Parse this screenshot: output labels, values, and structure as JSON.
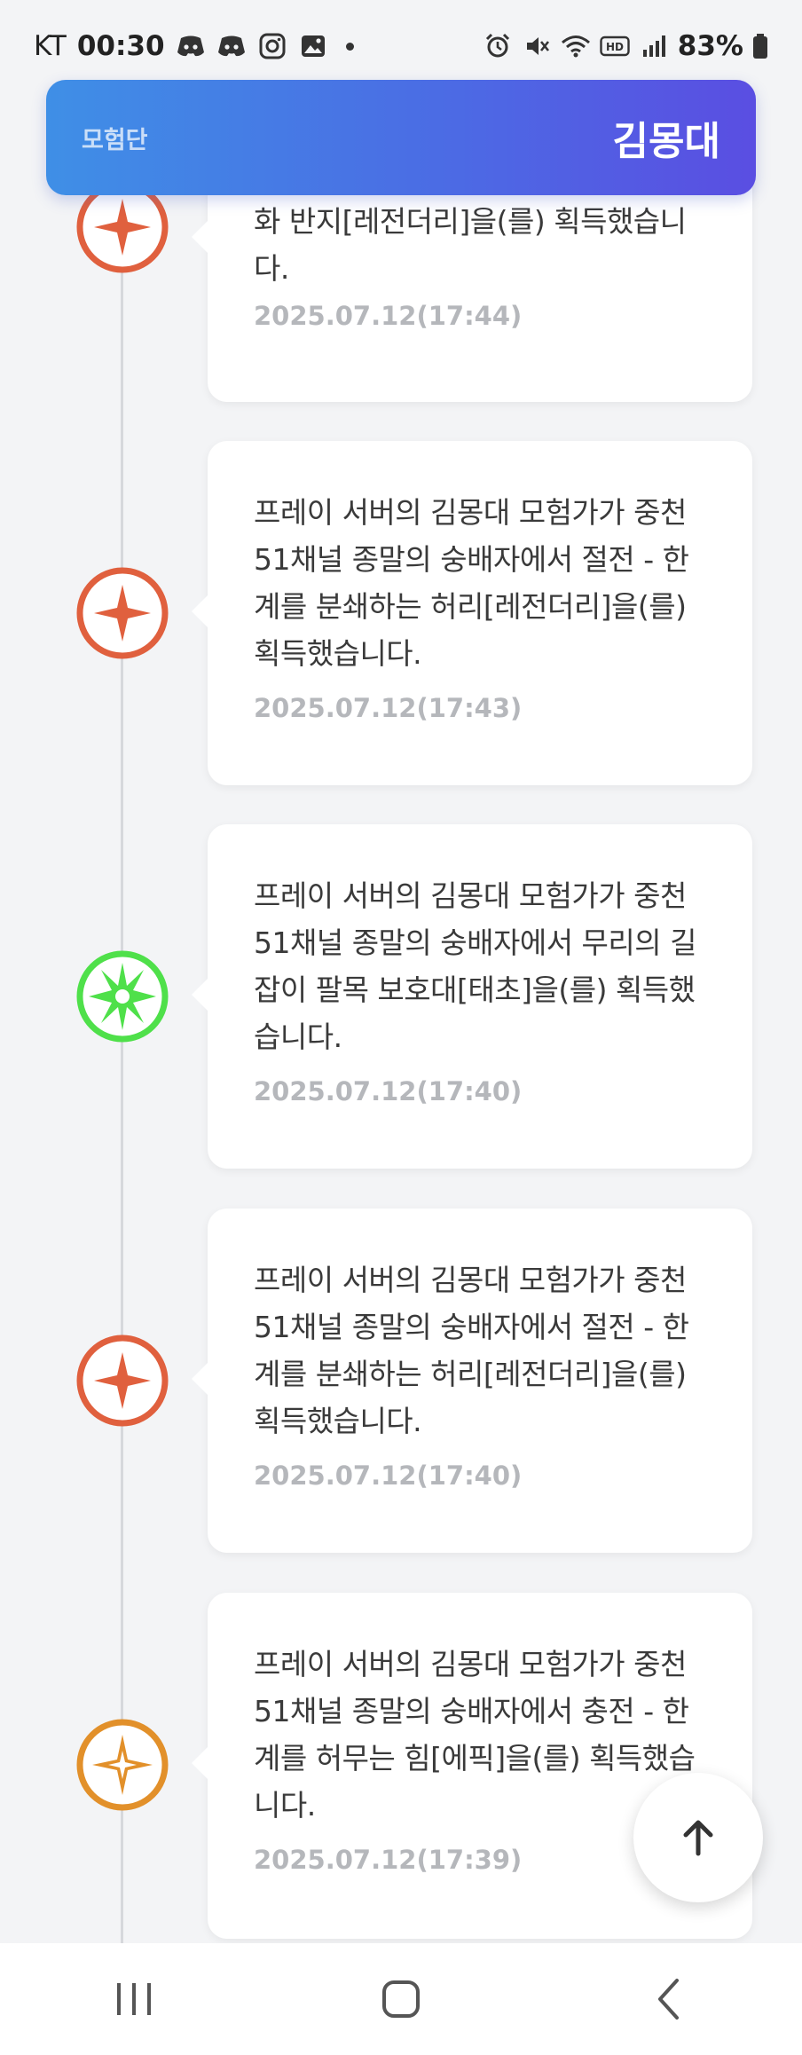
{
  "status_bar": {
    "carrier": "KT",
    "time": "00:30",
    "battery": "83%",
    "left_icons": [
      "discord-icon",
      "discord-icon",
      "instagram-icon",
      "gallery-icon"
    ],
    "right_icons": [
      "alarm-icon",
      "mute-icon",
      "wifi-icon",
      "hd-voice-icon",
      "signal-icon",
      "battery-icon"
    ]
  },
  "header": {
    "subtitle": "모험단",
    "title": "김몽대"
  },
  "feed": [
    {
      "message": "화 반지[레전더리]을(를) 획득했습니\n다.",
      "timestamp": "2025.07.12(17:44)",
      "rarity": "legendary",
      "color": "#e0603e"
    },
    {
      "message": "프레이 서버의 김몽대 모험가가 중천\n51채널 종말의 숭배자에서 절전 - 한\n계를 분쇄하는 허리[레전더리]을(를)\n획득했습니다.",
      "timestamp": "2025.07.12(17:43)",
      "rarity": "legendary",
      "color": "#e0603e"
    },
    {
      "message": "프레이 서버의 김몽대 모험가가 중천\n51채널 종말의 숭배자에서 무리의 길\n잡이 팔목 보호대[태초]을(를) 획득했\n습니다.",
      "timestamp": "2025.07.12(17:40)",
      "rarity": "primeval",
      "color": "#4fe04a"
    },
    {
      "message": "프레이 서버의 김몽대 모험가가 중천\n51채널 종말의 숭배자에서 절전 - 한\n계를 분쇄하는 허리[레전더리]을(를)\n획득했습니다.",
      "timestamp": "2025.07.12(17:40)",
      "rarity": "legendary",
      "color": "#e0603e"
    },
    {
      "message": "프레이 서버의 김몽대 모험가가 중천\n51채널 종말의 숭배자에서 충전 - 한\n계를 허무는 힘[에픽]을(를) 획득했습\n니다.",
      "timestamp": "2025.07.12(17:39)",
      "rarity": "epic",
      "color": "#e2902a"
    }
  ],
  "scroll_top_icon": "arrow-up-icon",
  "nav": {
    "recents_icon": "recents-icon",
    "home_icon": "home-icon",
    "back_icon": "back-icon"
  }
}
